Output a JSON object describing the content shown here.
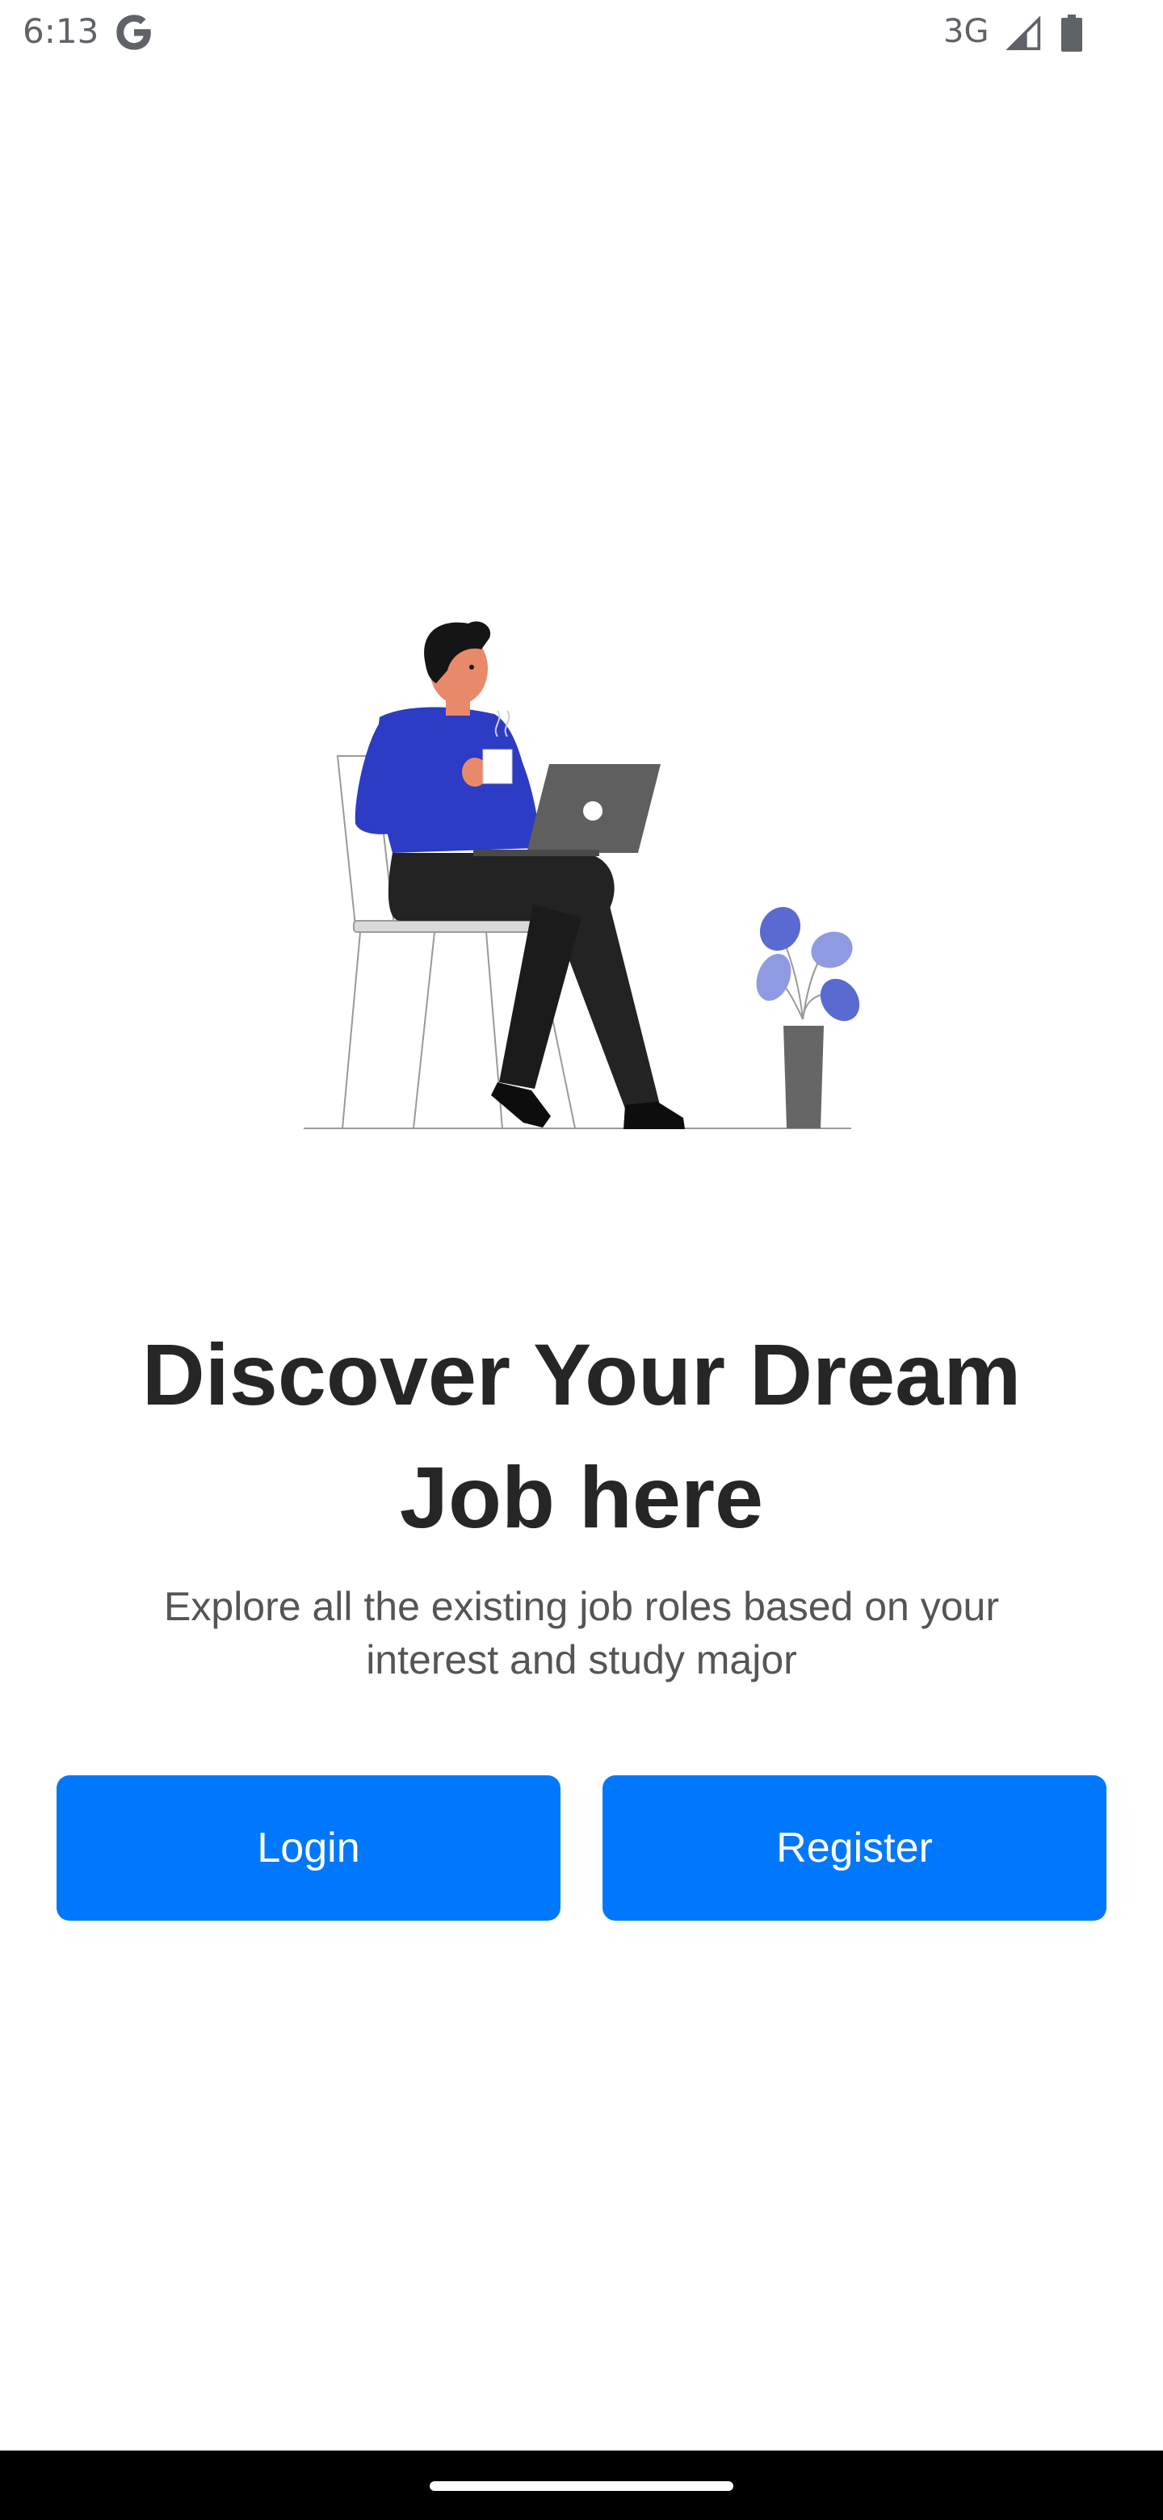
{
  "status_bar": {
    "time": "6:13",
    "network": "3G",
    "icons": [
      "google-icon",
      "signal-icon",
      "battery-icon"
    ]
  },
  "illustration": {
    "name": "person-with-laptop-illustration",
    "colors": {
      "sweater": "#2c3cc4",
      "pants": "#232323",
      "laptop": "#5f5f5f",
      "skin": "#e8896a",
      "hair": "#151515",
      "plant_leaf": "#5a6ad0",
      "plant_leaf_light": "#8f9be0",
      "vase": "#666666"
    }
  },
  "onboarding": {
    "headline": "Discover Your Dream Job here",
    "subtitle": "Explore all the existing job roles based on your interest and study major"
  },
  "buttons": {
    "login_label": "Login",
    "register_label": "Register",
    "color": "#0078fd"
  }
}
